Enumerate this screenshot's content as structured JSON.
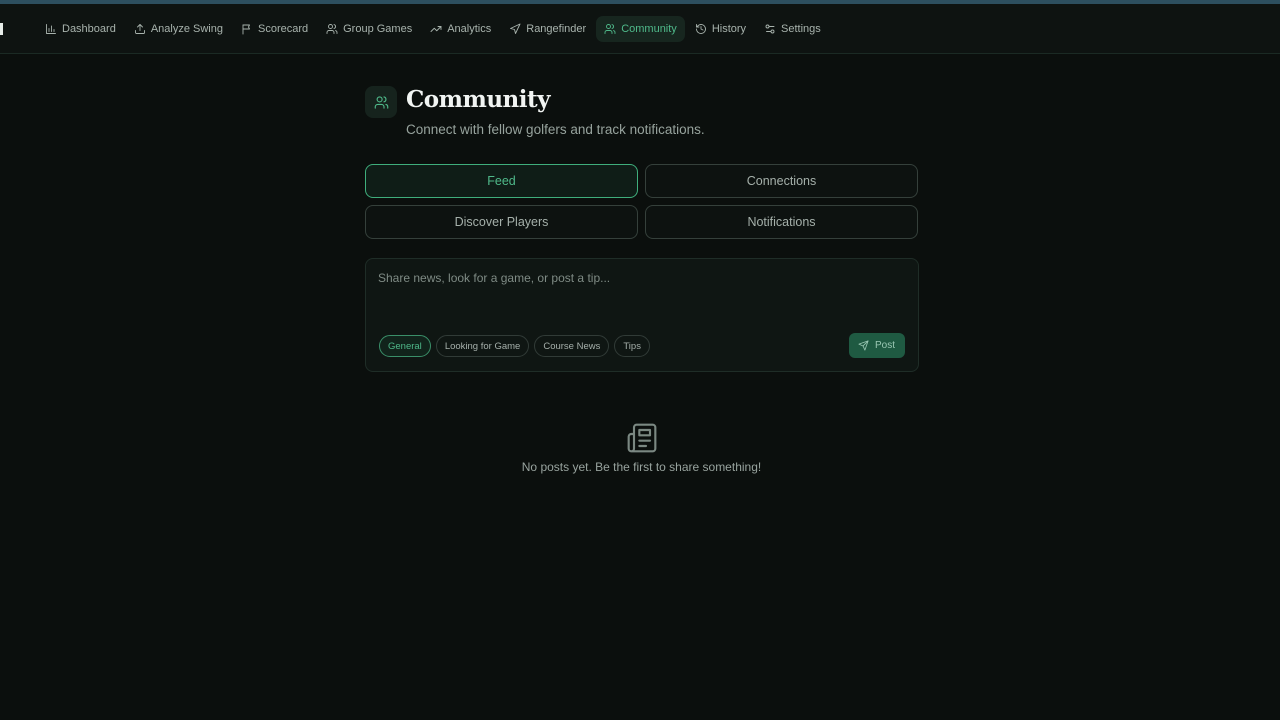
{
  "nav": {
    "items": [
      {
        "label": "Dashboard",
        "icon": "bar-chart-icon",
        "active": false
      },
      {
        "label": "Analyze Swing",
        "icon": "upload-icon",
        "active": false
      },
      {
        "label": "Scorecard",
        "icon": "flag-icon",
        "active": false
      },
      {
        "label": "Group Games",
        "icon": "users-icon",
        "active": false
      },
      {
        "label": "Analytics",
        "icon": "trending-up-icon",
        "active": false
      },
      {
        "label": "Rangefinder",
        "icon": "navigation-icon",
        "active": false
      },
      {
        "label": "Community",
        "icon": "users-icon",
        "active": true
      },
      {
        "label": "History",
        "icon": "history-icon",
        "active": false
      },
      {
        "label": "Settings",
        "icon": "sliders-icon",
        "active": false
      }
    ]
  },
  "page": {
    "title": "Community",
    "subtitle": "Connect with fellow golfers and track notifications.",
    "icon": "users-icon"
  },
  "tabs": [
    {
      "label": "Feed",
      "active": true
    },
    {
      "label": "Connections",
      "active": false
    },
    {
      "label": "Discover Players",
      "active": false
    },
    {
      "label": "Notifications",
      "active": false
    }
  ],
  "composer": {
    "placeholder": "Share news, look for a game, or post a tip...",
    "value": "",
    "categories": [
      {
        "label": "General",
        "active": true
      },
      {
        "label": "Looking for Game",
        "active": false
      },
      {
        "label": "Course News",
        "active": false
      },
      {
        "label": "Tips",
        "active": false
      }
    ],
    "post_label": "Post",
    "post_icon": "send-icon"
  },
  "empty_state": {
    "icon": "newspaper-icon",
    "message": "No posts yet. Be the first to share something!"
  },
  "colors": {
    "background": "#0b0f0d",
    "accent": "#4fb98a",
    "post_button": "#1f5a42",
    "top_bar": "#2d4f5f"
  }
}
